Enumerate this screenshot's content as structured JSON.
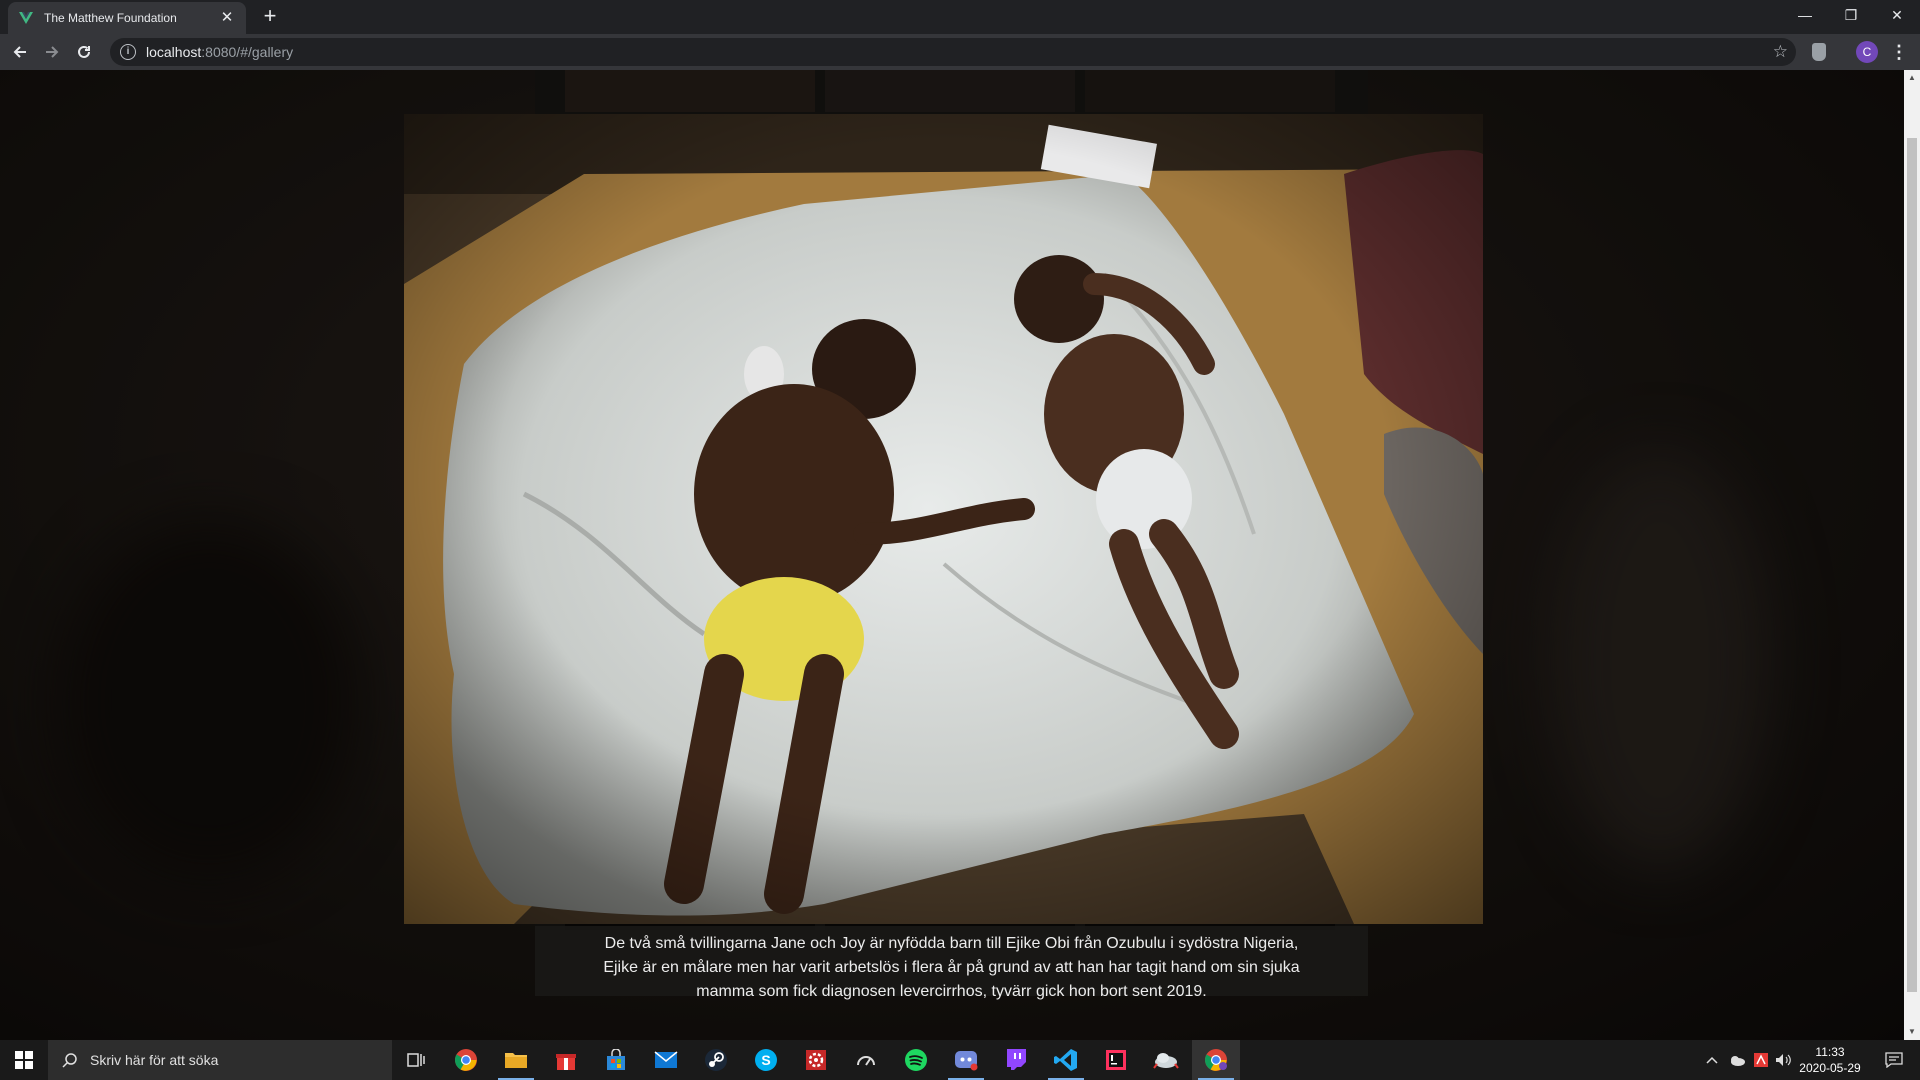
{
  "browser": {
    "tab_title": "The Matthew Foundation",
    "tab_close": "✕",
    "new_tab": "+",
    "url_host": "localhost",
    "url_path": ":8080/#/gallery",
    "avatar_letter": "C",
    "menu": "⋮",
    "window_controls": {
      "minimize": "—",
      "restore": "❐",
      "close": "✕"
    },
    "favicon_color": "#41b883"
  },
  "page": {
    "caption_line1": "De två små tvillingarna Jane och Joy är nyfödda barn till Ejike Obi från Ozubulu i sydöstra Nigeria,",
    "caption_line2": "Ejike är en målare men har varit arbetslös i flera år på grund av att han har tagit hand om sin sjuka",
    "caption_line3": "mamma som fick diagnosen levercirrhos, tyvärr gick hon bort sent 2019."
  },
  "taskbar": {
    "search_placeholder": "Skriv här för att söka",
    "time": "11:33",
    "date": "2020-05-29",
    "accent": "#7ab0e8"
  }
}
